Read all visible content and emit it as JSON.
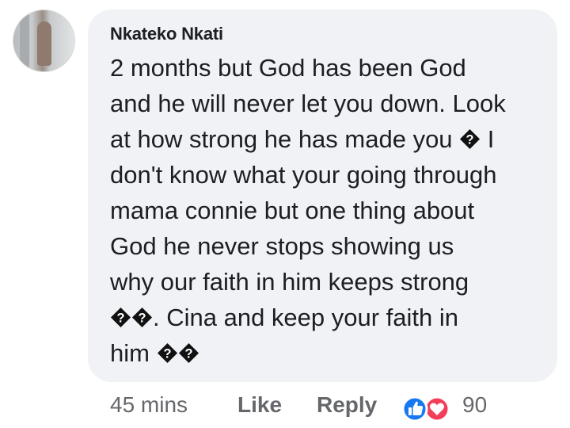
{
  "comment": {
    "author": "Nkateko Nkati",
    "lines": [
      "2 months but God has been God",
      "and he will never let you down. Look",
      "at how strong he has  made you ",
      " I",
      "don't know what your going through",
      "mama connie but one thing about",
      "God he never stops showing us",
      "why our faith in him keeps strong",
      ". Cina and keep your faith in",
      "him "
    ],
    "replacement_glyph": "�"
  },
  "actions": {
    "time": "45 mins",
    "like_label": "Like",
    "reply_label": "Reply",
    "reaction_count": "90"
  },
  "colors": {
    "bubble_bg": "#f0f2f5",
    "like_blue": "#1877f2",
    "love_red": "#f33e58",
    "meta_gray": "#65676b",
    "text": "#1c1e21"
  },
  "icons": {
    "like_reaction": "thumbs-up-icon",
    "love_reaction": "heart-icon",
    "unknown_emoji": "replacement-char-icon"
  }
}
